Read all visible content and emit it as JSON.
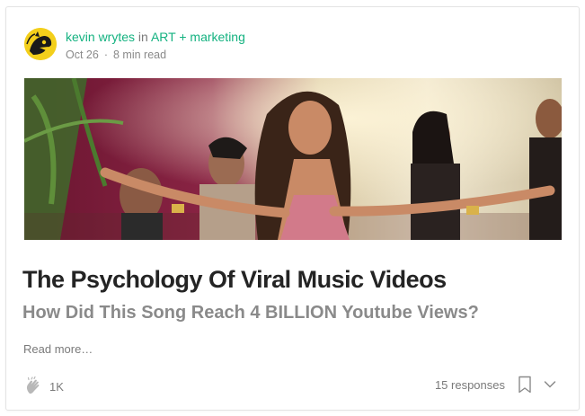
{
  "post": {
    "author": "kevin wrytes",
    "in_word": "in",
    "publication": "ART + marketing",
    "date": "Oct 26",
    "separator": "·",
    "read_time": "8 min read",
    "title": "The Psychology Of Viral Music Videos",
    "subtitle": "How Did This Song Reach 4 BILLION Youtube Views?",
    "read_more": "Read more…"
  },
  "footer": {
    "claps": "1K",
    "responses": "15 responses",
    "clap_icon": "clap-hands-icon",
    "bookmark_icon": "bookmark-icon",
    "more_icon": "chevron-down-icon"
  },
  "colors": {
    "accent": "#14b280",
    "title": "#242424",
    "muted": "#8a8a8a",
    "avatar_bg": "#f3cf1b"
  }
}
